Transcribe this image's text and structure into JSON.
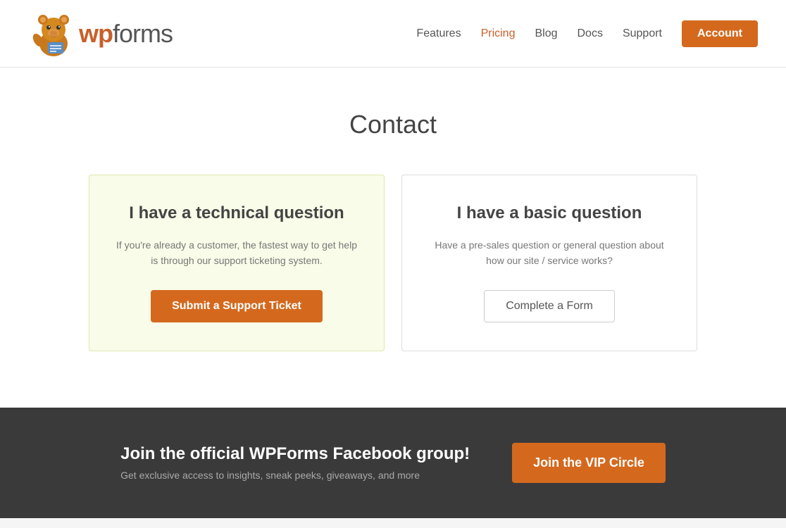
{
  "header": {
    "logo_text_wp": "wp",
    "logo_text_forms": "forms",
    "nav": {
      "features": "Features",
      "pricing": "Pricing",
      "blog": "Blog",
      "docs": "Docs",
      "support": "Support",
      "account": "Account"
    }
  },
  "main": {
    "page_title": "Contact",
    "card_technical": {
      "title": "I have a technical question",
      "description": "If you're already a customer, the fastest way to get help is through our support ticketing system.",
      "button": "Submit a Support Ticket"
    },
    "card_basic": {
      "title": "I have a basic question",
      "description": "Have a pre-sales question or general question about how our site / service works?",
      "button": "Complete a Form"
    }
  },
  "footer_cta": {
    "heading": "Join the official WPForms Facebook group!",
    "subtext": "Get exclusive access to insights, sneak peeks, giveaways, and more",
    "button": "Join the VIP Circle"
  },
  "icons": {
    "bear": "🐻"
  }
}
